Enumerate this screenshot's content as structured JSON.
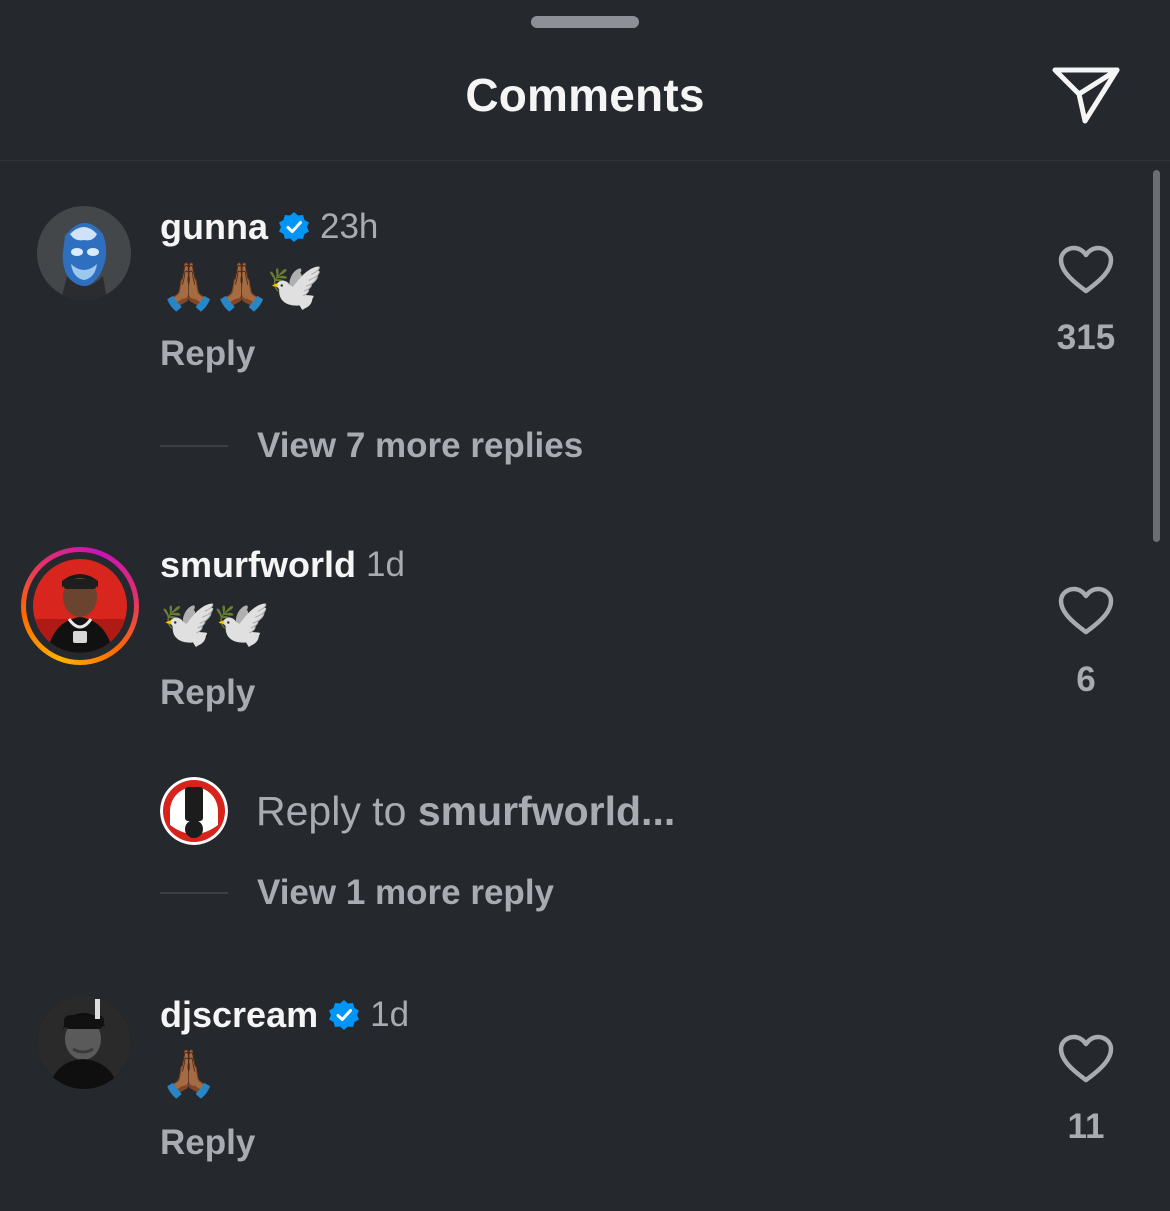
{
  "header": {
    "title": "Comments"
  },
  "comments": [
    {
      "username": "gunna",
      "verified": true,
      "time": "23h",
      "text": "🙏🏾🙏🏾🕊️",
      "reply_label": "Reply",
      "likes": "315",
      "more_replies": "View 7 more replies"
    },
    {
      "username": "smurfworld",
      "verified": false,
      "has_story": true,
      "time": "1d",
      "text": "🕊️🕊️",
      "reply_label": "Reply",
      "likes": "6",
      "reply_prompt_prefix": "Reply to ",
      "reply_prompt_user": "smurfworld...",
      "more_replies": "View 1 more reply"
    },
    {
      "username": "djscream",
      "verified": true,
      "time": "1d",
      "text": "🙏🏾",
      "reply_label": "Reply",
      "likes": "11"
    }
  ],
  "colors": {
    "background": "#25282d",
    "text_primary": "#f5f5f5",
    "text_secondary": "#a8abb1",
    "verified_blue": "#0095f6"
  },
  "icons": {
    "header_action": "send-icon",
    "like": "heart-outline-icon",
    "verified": "verified-badge-icon"
  }
}
